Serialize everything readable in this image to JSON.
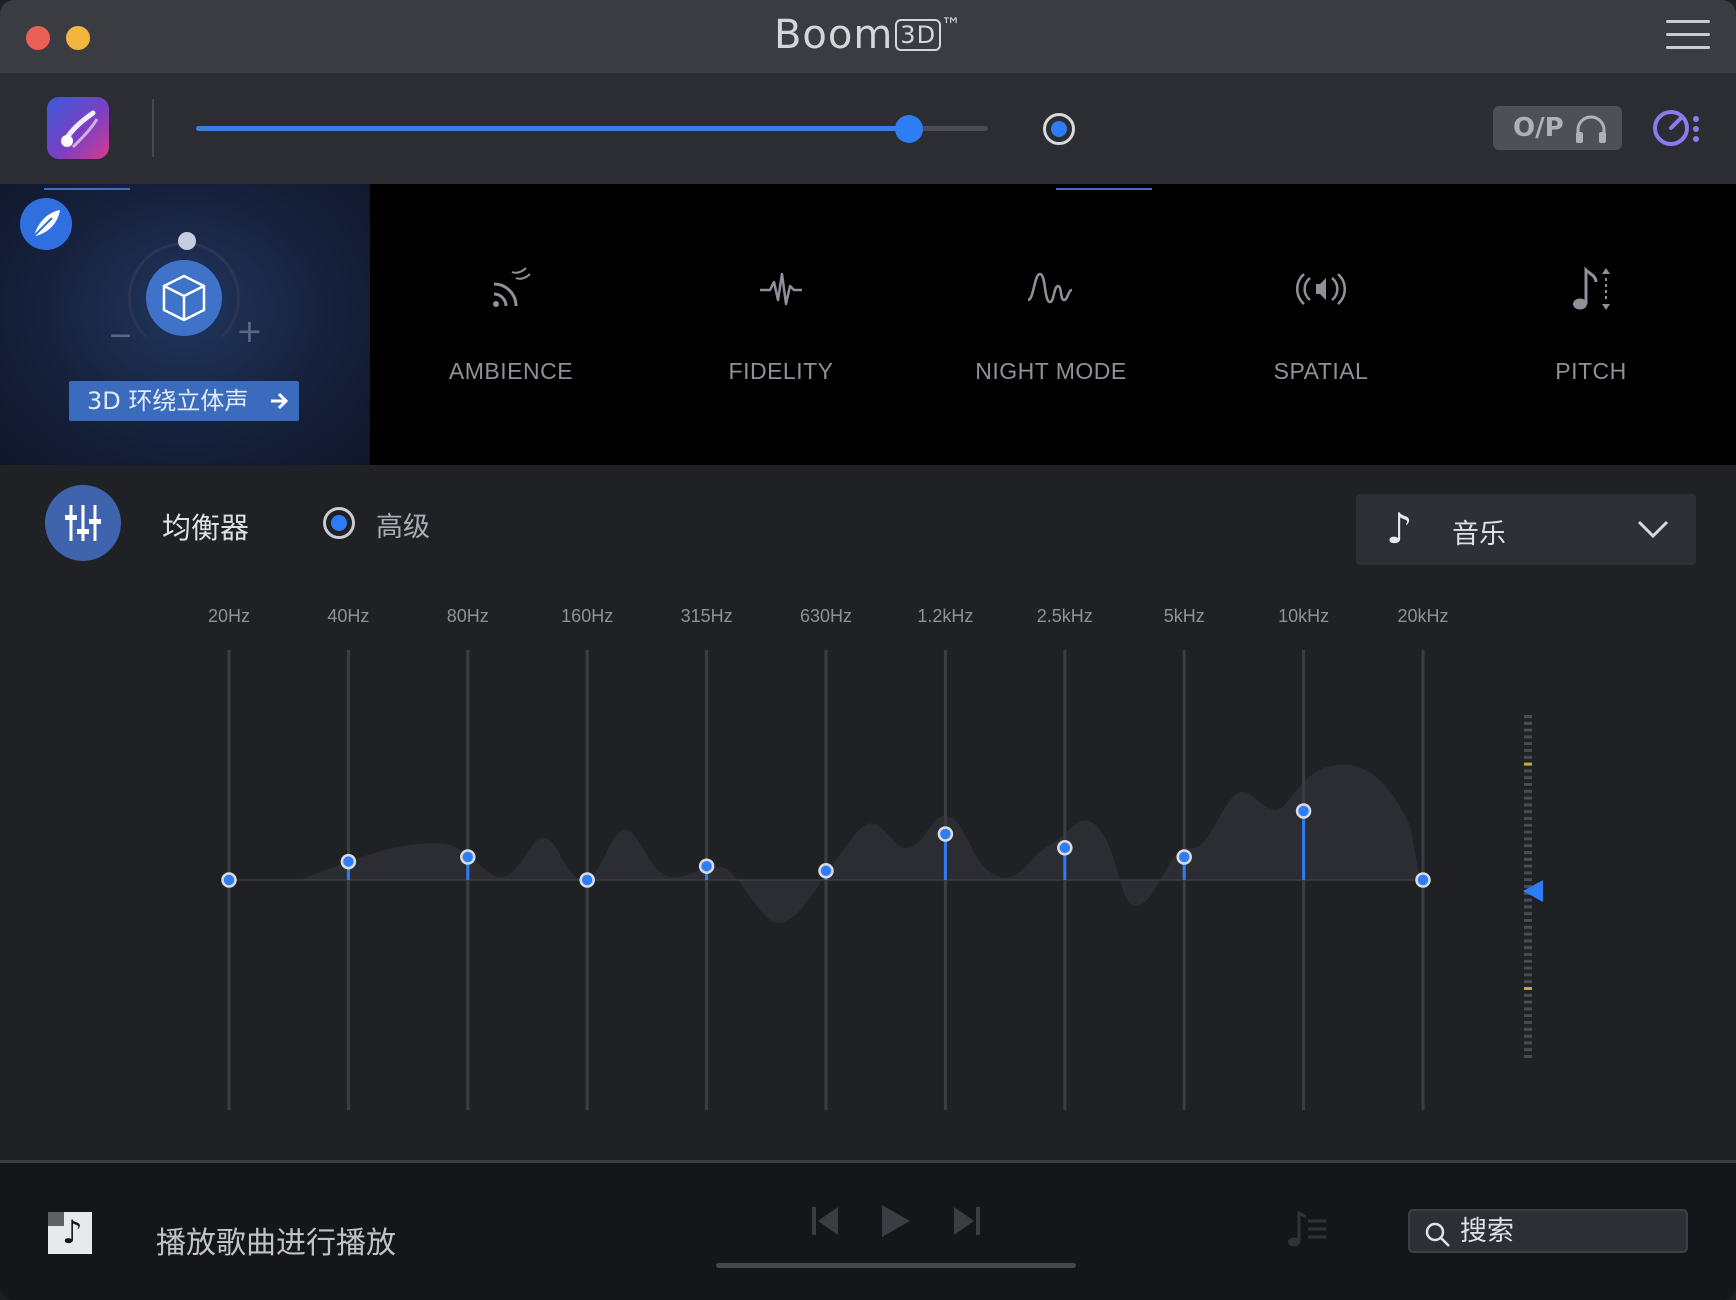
{
  "window": {
    "title": "Boom",
    "title_badge": "3D",
    "trademark": "™"
  },
  "toolbar": {
    "volume_level": 0.9,
    "output_label": "O/P"
  },
  "surround": {
    "label": "3D 环绕立体声"
  },
  "effects": [
    {
      "label": "AMBIENCE",
      "icon": "ambience-icon"
    },
    {
      "label": "FIDELITY",
      "icon": "fidelity-icon"
    },
    {
      "label": "NIGHT  MODE",
      "icon": "night-mode-icon"
    },
    {
      "label": "SPATIAL",
      "icon": "spatial-icon"
    },
    {
      "label": "PITCH",
      "icon": "pitch-icon"
    }
  ],
  "equalizer": {
    "title": "均衡器",
    "advanced_label": "高级",
    "advanced_selected": true,
    "preset": "音乐",
    "bands": [
      {
        "label": "20Hz",
        "gain": 0
      },
      {
        "label": "40Hz",
        "gain": 0.08
      },
      {
        "label": "80Hz",
        "gain": 0.1
      },
      {
        "label": "160Hz",
        "gain": 0
      },
      {
        "label": "315Hz",
        "gain": 0.06
      },
      {
        "label": "630Hz",
        "gain": 0.04
      },
      {
        "label": "1.2kHz",
        "gain": 0.2
      },
      {
        "label": "2.5kHz",
        "gain": 0.14
      },
      {
        "label": "5kHz",
        "gain": 0.1
      },
      {
        "label": "10kHz",
        "gain": 0.3
      },
      {
        "label": "20kHz",
        "gain": 0
      }
    ],
    "preamp_level": 0.5
  },
  "player": {
    "now_playing": "播放歌曲进行播放",
    "search_placeholder": "搜索"
  },
  "colors": {
    "accent": "#2f7df5",
    "background": "#1f2125"
  }
}
